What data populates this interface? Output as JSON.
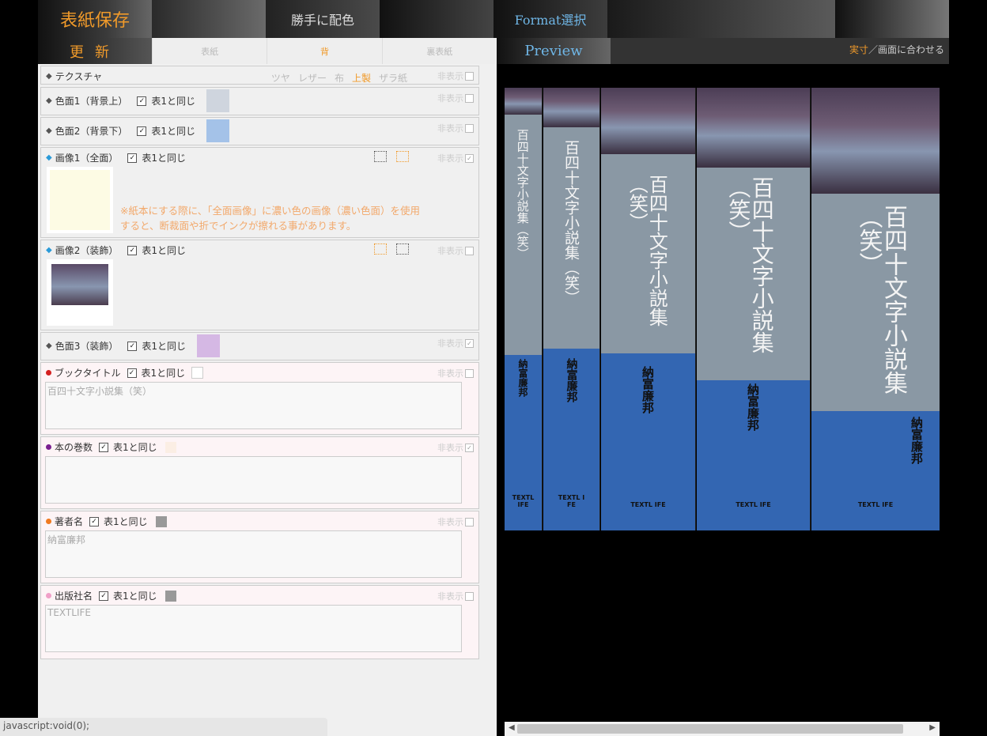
{
  "topbar": {
    "save": "表紙保存",
    "auto_color": "勝手に配色",
    "format": "Format選択"
  },
  "subtabs": {
    "update": "更新",
    "cover": "表紙",
    "spine": "背",
    "back": "裏表紙"
  },
  "hide_label": "非表示",
  "same_label": "表1と同じ",
  "rows": {
    "texture": {
      "label": "テクスチャ",
      "options": [
        "ツヤ",
        "レザー",
        "布",
        "上製",
        "ザラ紙"
      ]
    },
    "color1": {
      "label": "色面1（背景上）",
      "color": "#cfd5de"
    },
    "color2": {
      "label": "色面2（背景下）",
      "color": "#a4c2e8"
    },
    "image1": {
      "label": "画像1（全面）",
      "warning_line1": "※紙本にする際に、「全面画像」に濃い色の画像（濃い色面）を使用",
      "warning_line2": "すると、断裁面や折でインクが擦れる事があります。"
    },
    "image2": {
      "label": "画像2（装飾）"
    },
    "color3": {
      "label": "色面3（装飾）",
      "color": "#d5b8e4"
    },
    "book_title": {
      "label": "ブックタイトル",
      "value": "百四十文字小説集（笑）",
      "dot": "#d42020"
    },
    "volume": {
      "label": "本の巻数",
      "value": "",
      "dot": "#7a2090"
    },
    "author": {
      "label": "著者名",
      "value": "納富廉邦",
      "dot": "#f07a20"
    },
    "publisher": {
      "label": "出版社名",
      "value": "TEXTLIFE",
      "dot": "#f0a0c8"
    }
  },
  "preview": {
    "title": "Preview",
    "actual": "実寸",
    "fit": "画面に合わせる",
    "sep": "／"
  },
  "spines": {
    "title": "百四十文字小説集（笑）",
    "title_alt": "百四十文字小説集",
    "laugh": "（笑）",
    "author": "納富廉邦",
    "pub": "TEXTLIFE",
    "pub_split1": "TEXTL",
    "pub_split2": "IFE",
    "pub_split3": "TEXTL I",
    "pub_split4": "FE",
    "pub_spaced": "TEXTL IFE"
  },
  "status": "javascript:void(0);",
  "colors": {
    "accent": "#f09a2a",
    "blue": "#3366b2",
    "preview_blue": "#6fb6e6"
  }
}
